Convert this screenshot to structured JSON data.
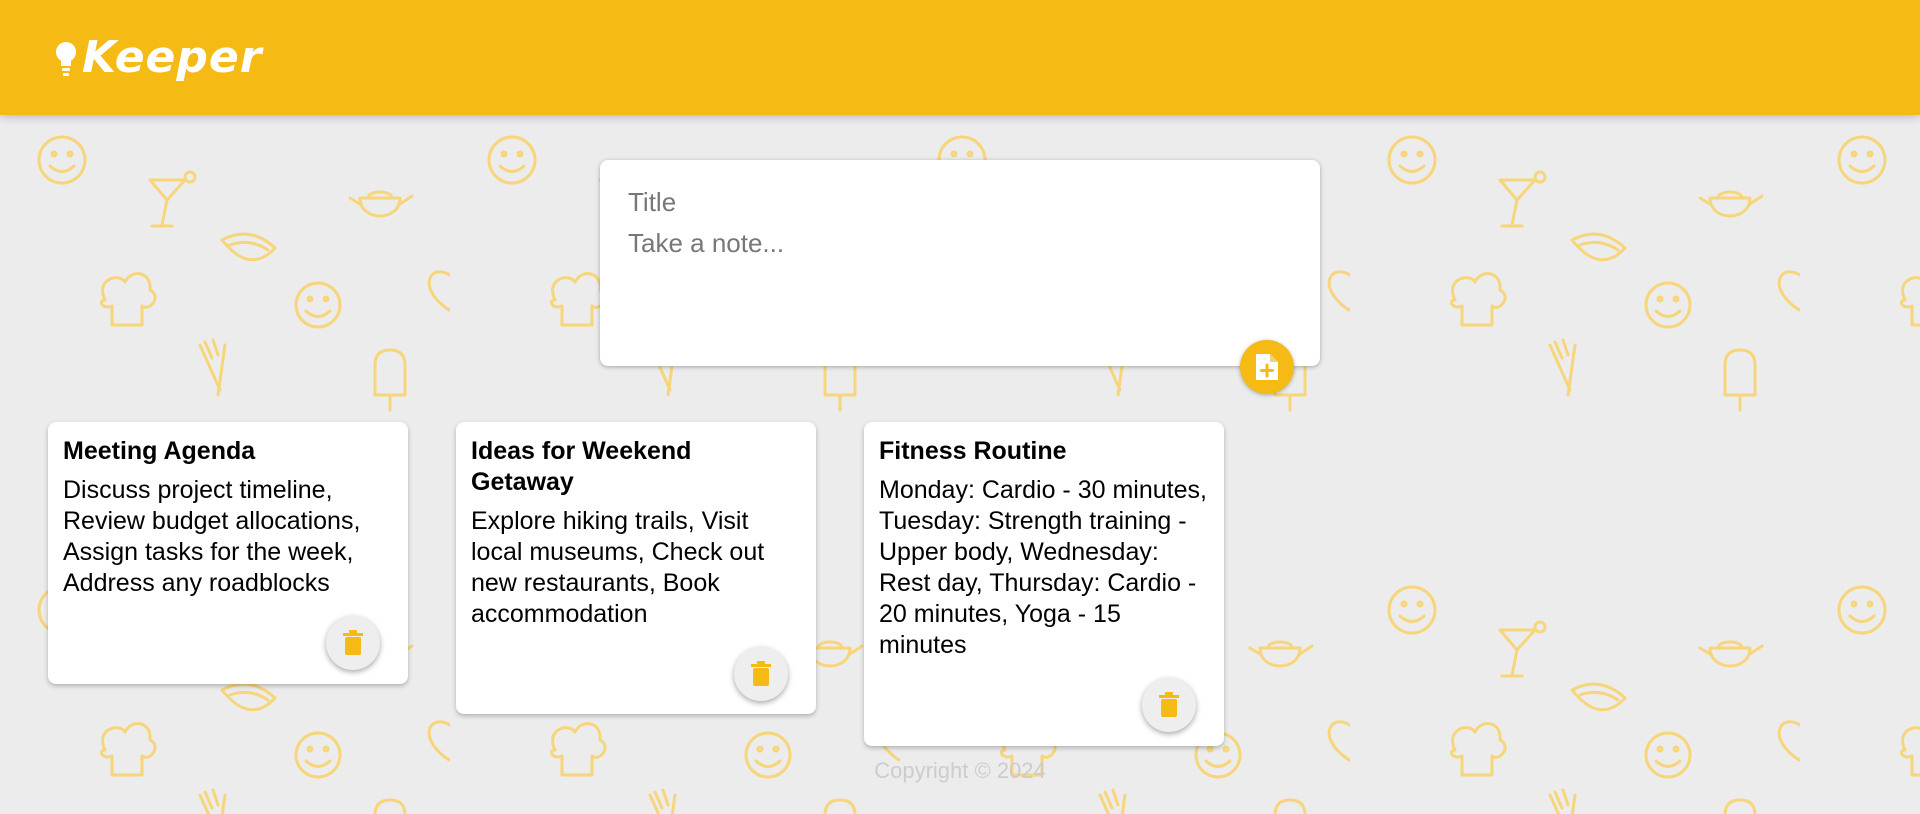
{
  "app": {
    "title": "Keeper",
    "logo_icon": "lightbulb-icon",
    "brand_color": "#f5ba14"
  },
  "create_note": {
    "title_placeholder": "Title",
    "content_placeholder": "Take a note...",
    "add_icon": "note-add-icon"
  },
  "notes": [
    {
      "title": "Meeting Agenda",
      "content": "Discuss project timeline, Review budget allocations, Assign tasks for the week, Address any roadblocks",
      "delete_icon": "trash-icon"
    },
    {
      "title": "Ideas for Weekend Getaway",
      "content": "Explore hiking trails, Visit local museums, Check out new restaurants, Book accommodation",
      "delete_icon": "trash-icon"
    },
    {
      "title": "Fitness Routine",
      "content": "Monday: Cardio - 30 minutes, Tuesday: Strength training - Upper body, Wednesday: Rest day, Thursday: Cardio - 20 minutes, Yoga - 15 minutes",
      "delete_icon": "trash-icon"
    }
  ],
  "footer": {
    "copyright": "Copyright © 2024"
  },
  "background": {
    "pattern_color": "#f7d57a",
    "base_color": "#ececec"
  }
}
